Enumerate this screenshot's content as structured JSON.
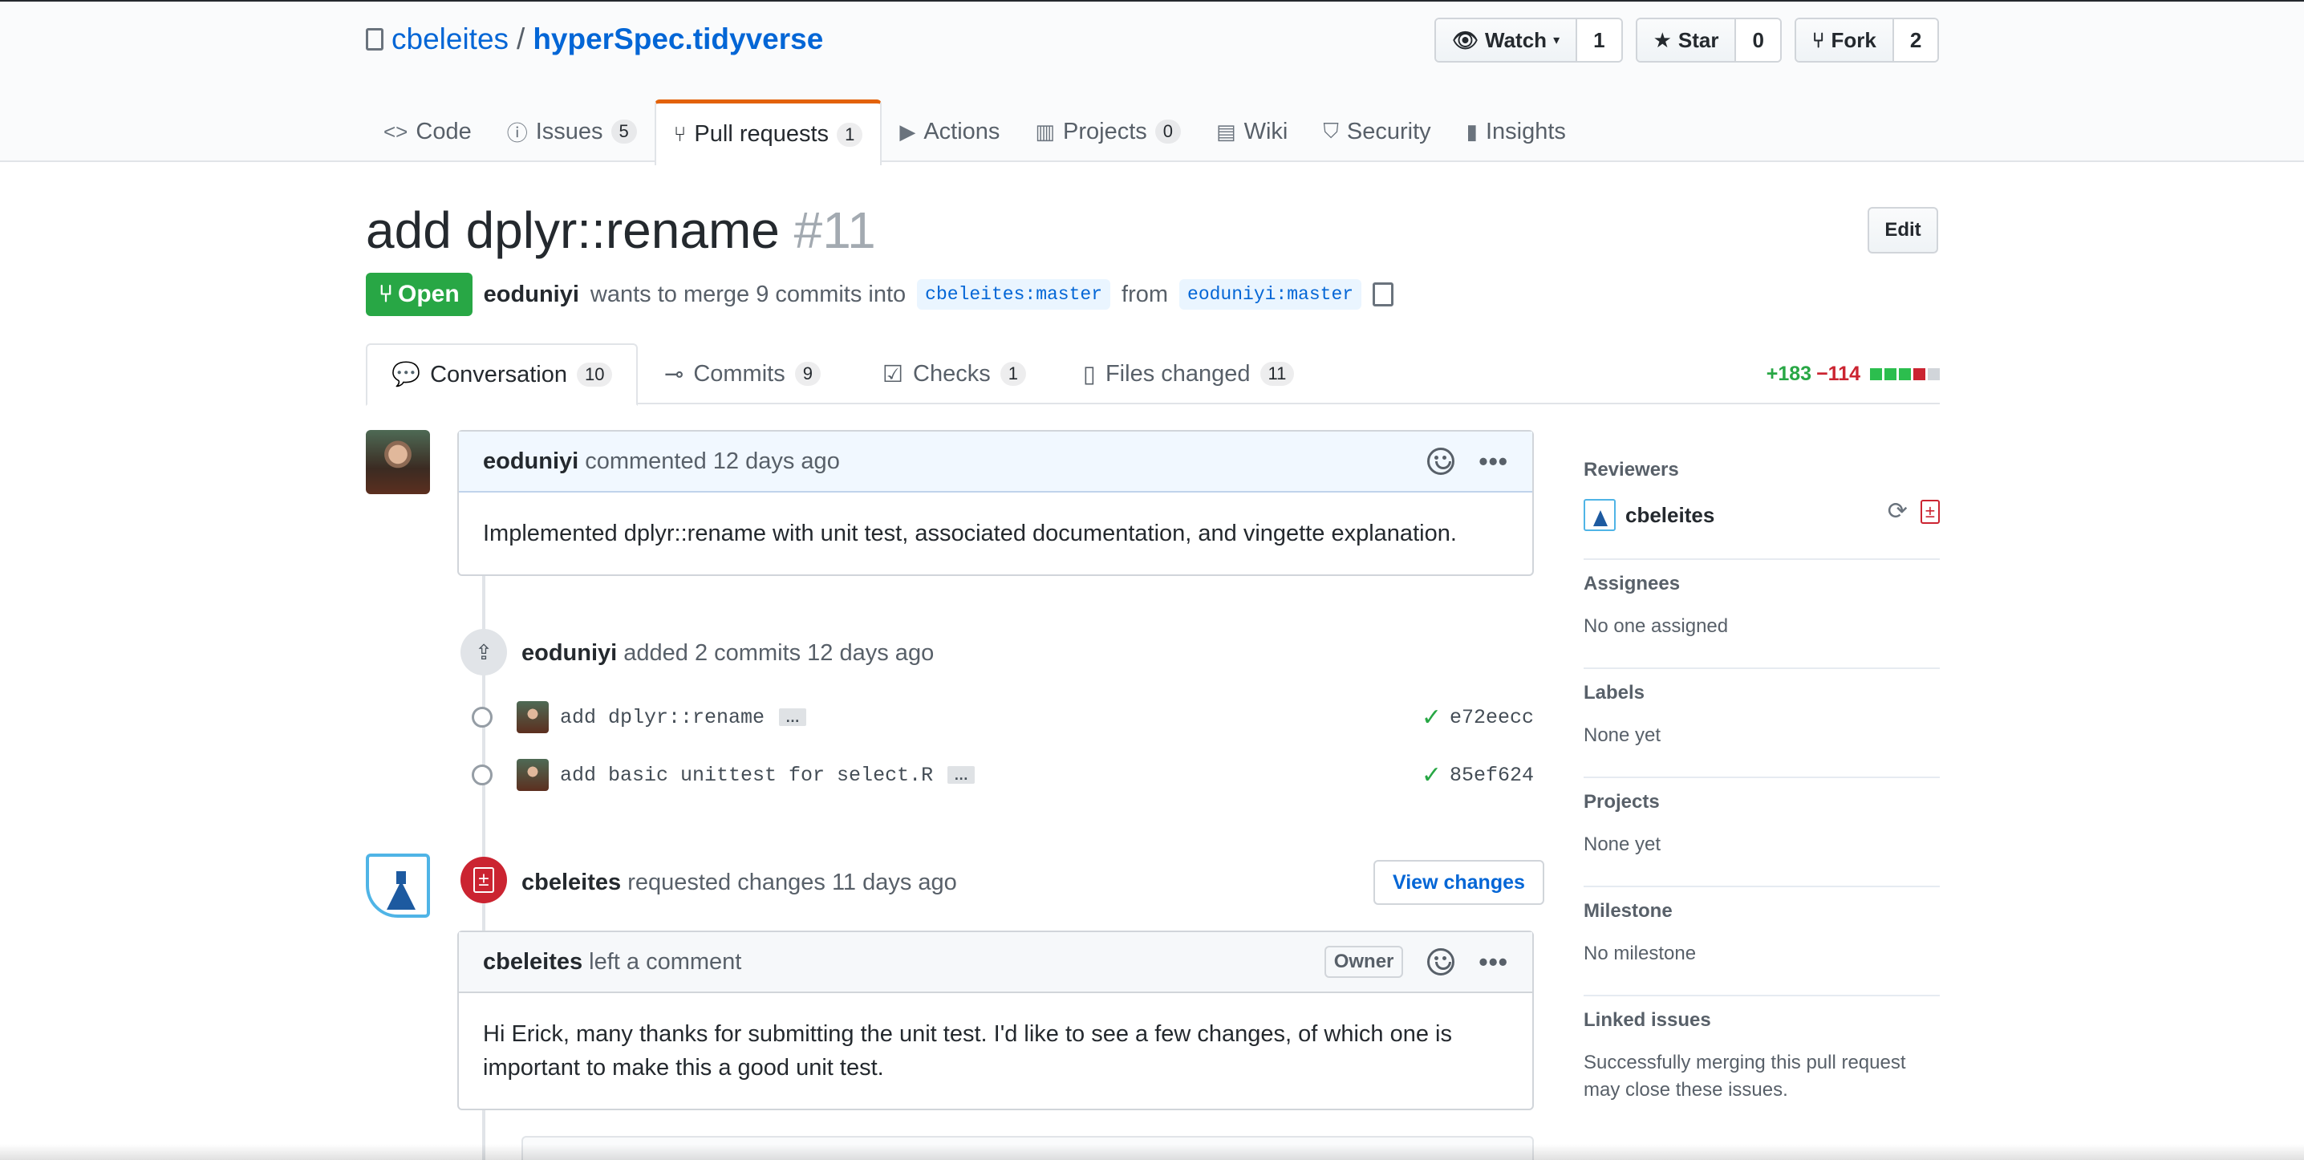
{
  "repo": {
    "owner": "cbeleites",
    "separator": "/",
    "name": "hyperSpec.tidyverse"
  },
  "actions": {
    "watch": {
      "label": "Watch",
      "count": "1"
    },
    "star": {
      "label": "Star",
      "count": "0"
    },
    "fork": {
      "label": "Fork",
      "count": "2"
    }
  },
  "nav": {
    "code": "Code",
    "issues": {
      "label": "Issues",
      "count": "5"
    },
    "pulls": {
      "label": "Pull requests",
      "count": "1"
    },
    "actions": "Actions",
    "projects": {
      "label": "Projects",
      "count": "0"
    },
    "wiki": "Wiki",
    "security": "Security",
    "insights": "Insights"
  },
  "pr": {
    "title": "add dplyr::rename",
    "number": "#11",
    "edit": "Edit",
    "state": "Open",
    "author": "eoduniyi",
    "merge_text": "wants to merge 9 commits into",
    "base_branch": "cbeleites:master",
    "from": "from",
    "head_branch": "eoduniyi:master"
  },
  "tabs": {
    "conversation": {
      "label": "Conversation",
      "count": "10"
    },
    "commits": {
      "label": "Commits",
      "count": "9"
    },
    "checks": {
      "label": "Checks",
      "count": "1"
    },
    "files": {
      "label": "Files changed",
      "count": "11"
    },
    "additions": "+183",
    "deletions": "−114"
  },
  "timeline": {
    "comment1": {
      "author": "eoduniyi",
      "meta": "commented 12 days ago",
      "body": "Implemented dplyr::rename with unit test, associated documentation, and vingette explanation."
    },
    "commits_event": {
      "author": "eoduniyi",
      "text": "added 2 commits 12 days ago",
      "commits": [
        {
          "message": "add dplyr::rename",
          "sha": "e72eecc"
        },
        {
          "message": "add basic unittest for select.R",
          "sha": "85ef624"
        }
      ],
      "ellipsis": "…"
    },
    "review": {
      "author": "cbeleites",
      "text": "requested changes 11 days ago",
      "view_button": "View changes"
    },
    "comment2": {
      "author": "cbeleites",
      "meta": "left a comment",
      "owner_badge": "Owner",
      "body": "Hi Erick, many thanks for submitting the unit test. I'd like to see a few changes, of which one is important to make this a good unit test."
    }
  },
  "sidebar": {
    "reviewers": {
      "title": "Reviewers",
      "name": "cbeleites"
    },
    "assignees": {
      "title": "Assignees",
      "value": "No one assigned"
    },
    "labels": {
      "title": "Labels",
      "value": "None yet"
    },
    "projects": {
      "title": "Projects",
      "value": "None yet"
    },
    "milestone": {
      "title": "Milestone",
      "value": "No milestone"
    },
    "linked": {
      "title": "Linked issues",
      "value": "Successfully merging this pull request may close these issues."
    }
  },
  "colors": {
    "link": "#0366d6",
    "open": "#28a745",
    "changes_requested": "#cb2431",
    "active_tab": "#e36209"
  }
}
